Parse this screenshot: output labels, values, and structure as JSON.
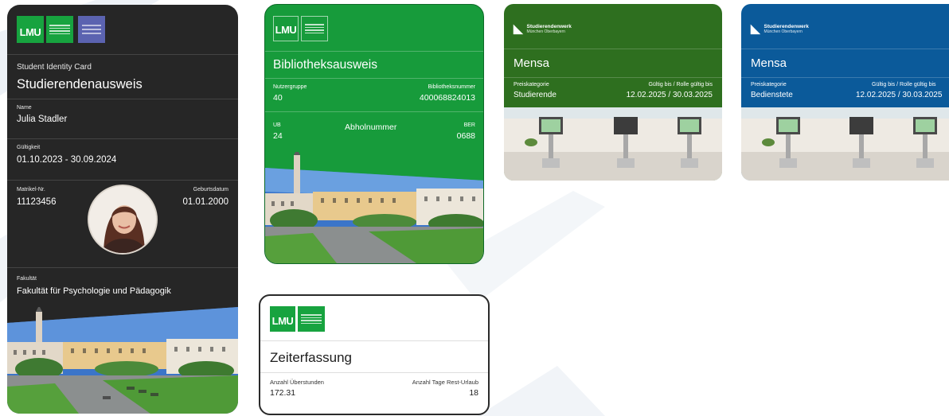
{
  "student_card": {
    "title_en": "Student Identity Card",
    "title_de": "Studierendenausweis",
    "name_label": "Name",
    "name": "Julia Stadler",
    "validity_label": "Gültigkeit",
    "validity": "01.10.2023 - 30.09.2024",
    "matrikel_label": "Matrikel-Nr.",
    "matrikel": "11123456",
    "birthdate_label": "Geburtsdatum",
    "birthdate": "01.01.2000",
    "faculty_label": "Fakultät",
    "faculty": "Fakultät für Psychologie und Pädagogik"
  },
  "library_card": {
    "title": "Bibliotheksausweis",
    "user_group_label": "Nutzergruppe",
    "user_group": "40",
    "library_number_label": "Bibliotheksnummer",
    "library_number": "400068824013",
    "ub_label": "UB",
    "ub": "24",
    "pickup_label": "Abholnummer",
    "ber_label": "BER",
    "ber": "0688"
  },
  "mensa_cards": [
    {
      "logo_line1": "Studierendenwerk",
      "logo_line2": "München Oberbayern",
      "title": "Mensa",
      "price_label": "Preiskategorie",
      "price_value": "Studierende",
      "valid_label": "Gültig bis / Rolle gültig bis",
      "valid_value": "12.02.2025 / 30.03.2025",
      "color": "#2e6f1f"
    },
    {
      "logo_line1": "Studierendenwerk",
      "logo_line2": "München Oberbayern",
      "title": "Mensa",
      "price_label": "Preiskategorie",
      "price_value": "Bedienstete",
      "valid_label": "Gültig bis / Rolle gültig bis",
      "valid_value": "12.02.2025 / 30.03.2025",
      "color": "#0b5a9a"
    }
  ],
  "time_card": {
    "title": "Zeiterfassung",
    "overtime_label": "Anzahl Überstunden",
    "overtime": "172.31",
    "vacation_label": "Anzahl Tage Rest-Urlaub",
    "vacation": "18"
  },
  "logo": {
    "lmu": "LMU"
  },
  "colors": {
    "lmu_green": "#17a33f",
    "student_card_bg": "#262626",
    "mensa_student": "#2e6f1f",
    "mensa_staff": "#0b5a9a"
  }
}
